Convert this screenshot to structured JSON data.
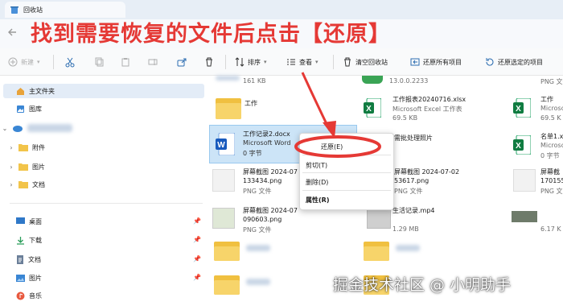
{
  "window": {
    "tab_title": "回收站"
  },
  "annotation": {
    "instruction": "找到需要恢复的文件后点击【还原】",
    "arrow_color": "#e53935",
    "circle_color": "#e53935"
  },
  "toolbar": {
    "new_label": "新建",
    "sort_label": "排序",
    "view_label": "查看",
    "empty_bin_label": "清空回收站",
    "restore_all_label": "还原所有项目",
    "restore_selected_label": "还原选定的项目"
  },
  "sidebar": {
    "home": "主文件夹",
    "gallery": "图库",
    "folders": [
      "附件",
      "图片",
      "文档"
    ],
    "quick_access": [
      "桌面",
      "下载",
      "文档",
      "图片",
      "音乐"
    ]
  },
  "files": {
    "col1": [
      {
        "name": "",
        "sub": "161 KB"
      },
      {
        "name": "工作",
        "sub": ""
      },
      {
        "name": "工作记录2.docx",
        "sub": "Microsoft Word",
        "sub2": "0 字节"
      },
      {
        "name": "屏幕截图 2024-07",
        "sub": "133434.png",
        "sub2": "PNG 文件"
      },
      {
        "name": "屏幕截图 2024-07",
        "sub": "090603.png",
        "sub2": "PNG 文件"
      }
    ],
    "col2": [
      {
        "name": "13.0.0.2233",
        "sub": ""
      },
      {
        "name": "工作报表20240716.xlsx",
        "sub": "Microsoft Excel 工作表",
        "sub2": "69.5 KB"
      },
      {
        "name": "需批处理照片",
        "sub": ""
      },
      {
        "name": "屏幕截图 2024-07-02",
        "sub": "53617.png",
        "sub2": "PNG 文件"
      },
      {
        "name": "生活记录.mp4",
        "sub": "",
        "sub2": "1.29 MB"
      }
    ],
    "col3": [
      {
        "name": "PNG 文件",
        "sub": ""
      },
      {
        "name": "工作",
        "sub": "Microsoft",
        "sub2": "69.5 K"
      },
      {
        "name": "名单1.x",
        "sub": "Microsof",
        "sub2": "0 字节"
      },
      {
        "name": "屏幕截",
        "sub": "170155",
        "sub2": "PNG 文"
      },
      {
        "name": "6.17 K",
        "sub": ""
      }
    ]
  },
  "context_menu": {
    "items": [
      "还原(E)",
      "剪切(T)",
      "删除(D)",
      "属性(R)"
    ]
  },
  "watermark": "掘金技术社区 @ 小明助手"
}
